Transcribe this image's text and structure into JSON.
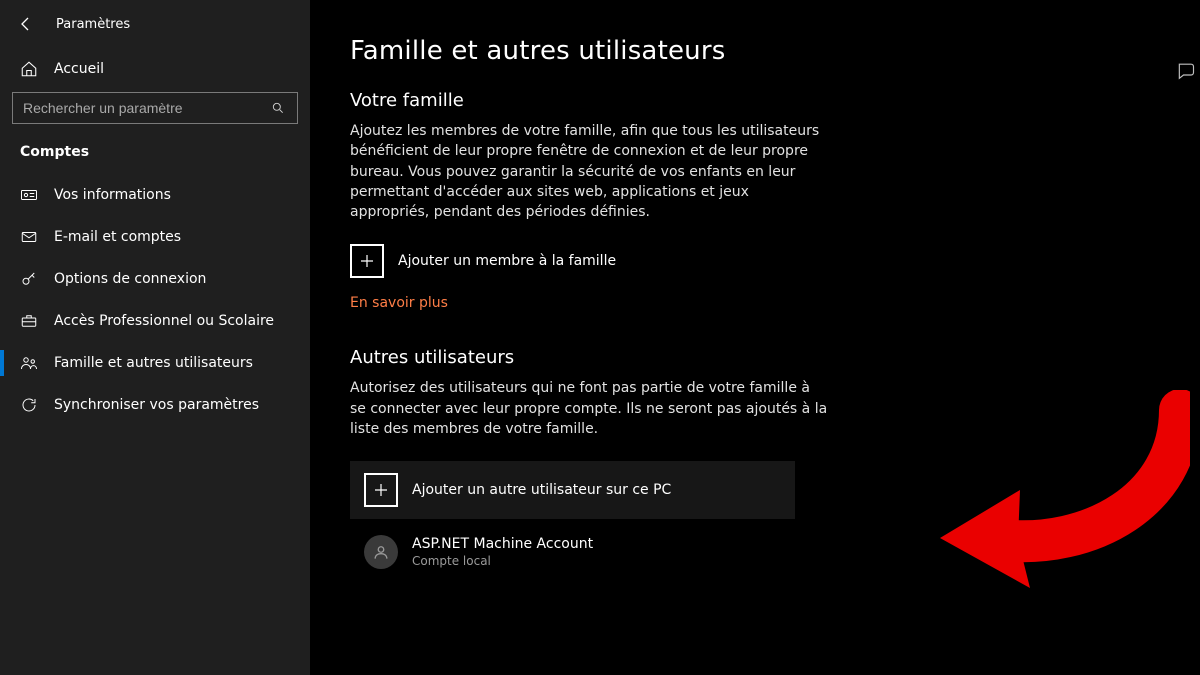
{
  "window": {
    "title": "Paramètres"
  },
  "sidebar": {
    "home_label": "Accueil",
    "search_placeholder": "Rechercher un paramètre",
    "section_label": "Comptes",
    "items": [
      {
        "label": "Vos informations"
      },
      {
        "label": "E-mail et comptes"
      },
      {
        "label": "Options de connexion"
      },
      {
        "label": "Accès Professionnel ou Scolaire"
      },
      {
        "label": "Famille et autres utilisateurs"
      },
      {
        "label": "Synchroniser vos paramètres"
      }
    ],
    "active_index": 4
  },
  "main": {
    "page_title": "Famille et autres utilisateurs",
    "family_heading": "Votre famille",
    "family_paragraph": "Ajoutez les membres de votre famille, afin que tous les utilisateurs bénéficient de leur propre fenêtre de connexion et de leur propre bureau. Vous pouvez garantir la sécurité de vos enfants en leur permettant d'accéder aux sites web, applications et jeux appropriés, pendant des périodes définies.",
    "add_family_label": "Ajouter un membre à la famille",
    "learn_more_label": "En savoir plus",
    "others_heading": "Autres utilisateurs",
    "others_paragraph": "Autorisez des utilisateurs qui ne font pas partie de votre famille à se connecter avec leur propre compte. Ils ne seront pas ajoutés à la liste des membres de votre famille.",
    "add_other_label": "Ajouter un autre utilisateur sur ce PC",
    "accounts": [
      {
        "name": "ASP.NET Machine Account",
        "subtitle": "Compte local"
      }
    ]
  }
}
